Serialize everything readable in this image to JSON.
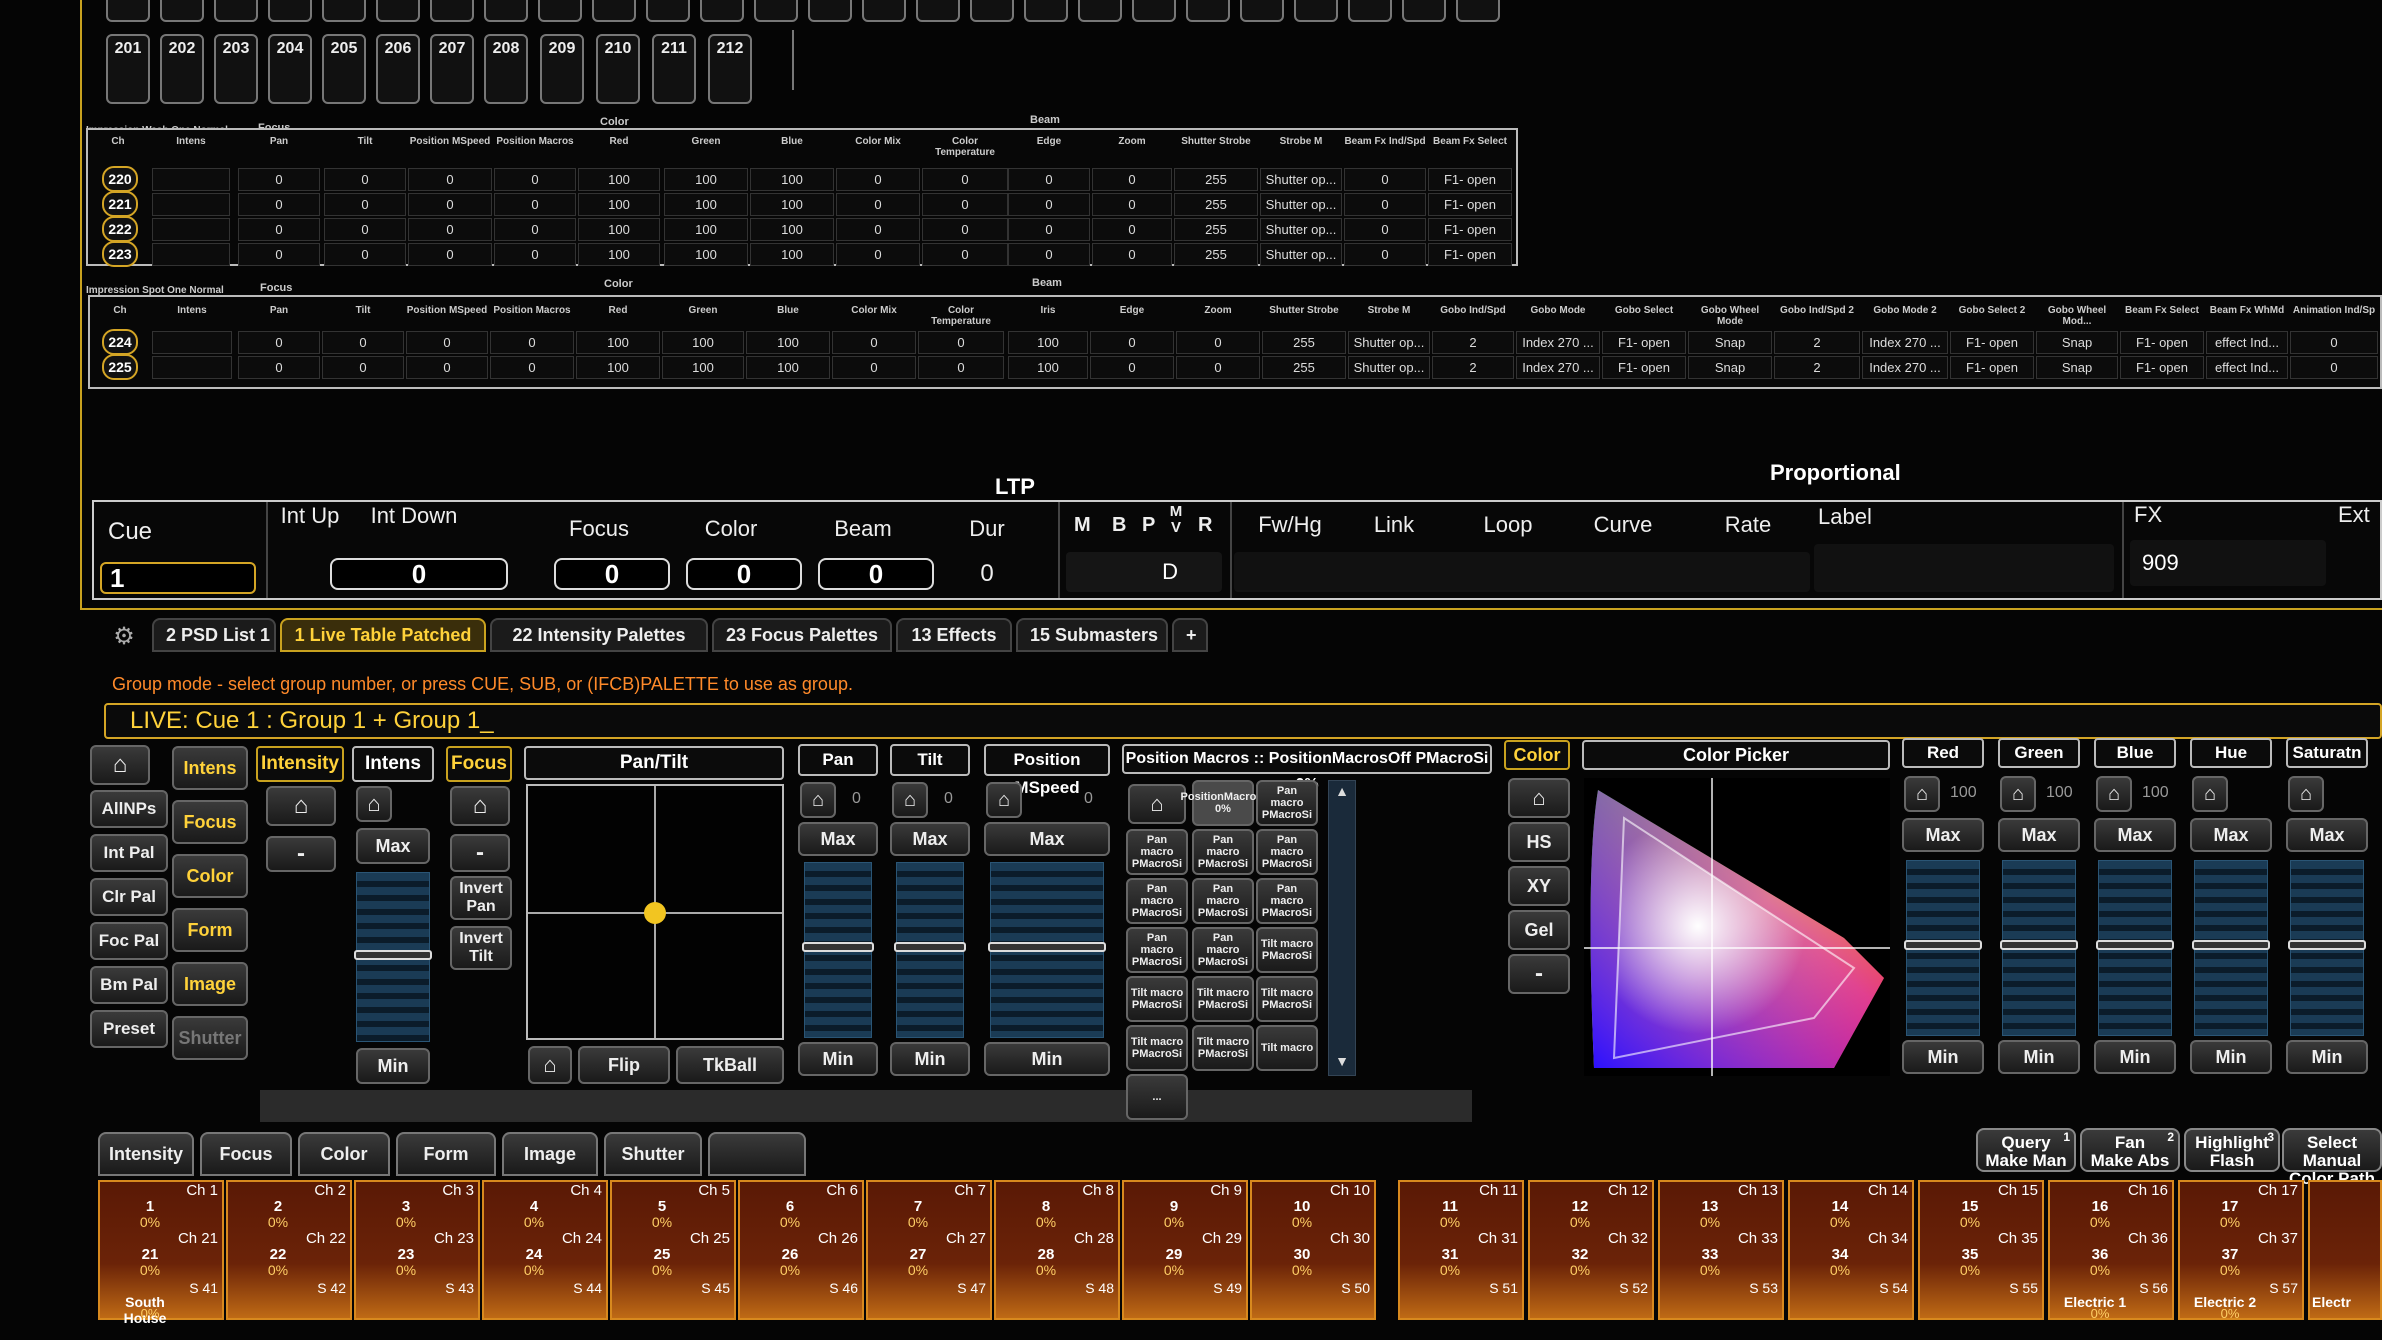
{
  "top_channels": [
    "201",
    "202",
    "203",
    "204",
    "205",
    "206",
    "207",
    "208",
    "209",
    "210",
    "211",
    "212"
  ],
  "table1": {
    "title": "Impression Wash One Normal",
    "groups": [
      "Focus",
      "Color",
      "Beam"
    ],
    "headers": [
      "Ch",
      "Intens",
      "Pan",
      "Tilt",
      "Position MSpeed",
      "Position Macros",
      "Red",
      "Green",
      "Blue",
      "Color Mix",
      "Color Temperature",
      "Edge",
      "Zoom",
      "Shutter Strobe",
      "Strobe M",
      "Beam Fx Ind/Spd",
      "Beam Fx Select"
    ],
    "rows": [
      {
        "ch": "220",
        "vals": [
          "0",
          "0",
          "0",
          "0",
          "100",
          "100",
          "100",
          "0",
          "0",
          "0",
          "0",
          "255",
          "Shutter op...",
          "0",
          "F1- open"
        ]
      },
      {
        "ch": "221",
        "vals": [
          "0",
          "0",
          "0",
          "0",
          "100",
          "100",
          "100",
          "0",
          "0",
          "0",
          "0",
          "255",
          "Shutter op...",
          "0",
          "F1- open"
        ]
      },
      {
        "ch": "222",
        "vals": [
          "0",
          "0",
          "0",
          "0",
          "100",
          "100",
          "100",
          "0",
          "0",
          "0",
          "0",
          "255",
          "Shutter op...",
          "0",
          "F1- open"
        ]
      },
      {
        "ch": "223",
        "vals": [
          "0",
          "0",
          "0",
          "0",
          "100",
          "100",
          "100",
          "0",
          "0",
          "0",
          "0",
          "255",
          "Shutter op...",
          "0",
          "F1- open"
        ]
      }
    ]
  },
  "table2": {
    "title": "Impression Spot One Normal",
    "groups": [
      "Focus",
      "Color",
      "Beam"
    ],
    "headers": [
      "Ch",
      "Intens",
      "Pan",
      "Tilt",
      "Position MSpeed",
      "Position Macros",
      "Red",
      "Green",
      "Blue",
      "Color Mix",
      "Color Temperature",
      "Iris",
      "Edge",
      "Zoom",
      "Shutter Strobe",
      "Strobe M",
      "Gobo Ind/Spd",
      "Gobo Mode",
      "Gobo Select",
      "Gobo Wheel Mode",
      "Gobo Ind/Spd 2",
      "Gobo Mode 2",
      "Gobo Select 2",
      "Gobo Wheel Mod...",
      "Beam Fx Select",
      "Beam Fx WhMd",
      "Animation Ind/Sp"
    ],
    "rows": [
      {
        "ch": "224",
        "vals": [
          "0",
          "0",
          "0",
          "0",
          "100",
          "100",
          "100",
          "0",
          "0",
          "100",
          "0",
          "0",
          "255",
          "Shutter op...",
          "2",
          "Index 270 ...",
          "F1- open",
          "Snap",
          "2",
          "Index 270 ...",
          "F1- open",
          "Snap",
          "F1- open",
          "effect Ind...",
          "0"
        ]
      },
      {
        "ch": "225",
        "vals": [
          "0",
          "0",
          "0",
          "0",
          "100",
          "100",
          "100",
          "0",
          "0",
          "100",
          "0",
          "0",
          "255",
          "Shutter op...",
          "2",
          "Index 270 ...",
          "F1- open",
          "Snap",
          "2",
          "Index 270 ...",
          "F1- open",
          "Snap",
          "F1- open",
          "effect Ind...",
          "0"
        ]
      }
    ]
  },
  "cue": {
    "ltp_label": "LTP",
    "prop_label": "Proportional",
    "headers": {
      "cue": "Cue",
      "int_up": "Int Up",
      "int_down": "Int Down",
      "focus": "Focus",
      "color": "Color",
      "beam": "Beam",
      "dur": "Dur",
      "m": "M",
      "b": "B",
      "p": "P",
      "mv": "M V",
      "r": "R",
      "fwhg": "Fw/Hg",
      "link": "Link",
      "loop": "Loop",
      "curve": "Curve",
      "rate": "Rate",
      "label": "Label",
      "fx": "FX",
      "ext": "Ext"
    },
    "values": {
      "cue": "1",
      "int_up": "0",
      "int_down": "0",
      "focus": "0",
      "color": "0",
      "beam": "0",
      "dur": "0",
      "flag": "D",
      "fx": "909"
    }
  },
  "tabs": [
    "2 PSD List 1",
    "1 Live Table Patched",
    "22 Intensity Palettes",
    "23 Focus Palettes",
    "13 Effects",
    "15 Submasters",
    "+"
  ],
  "hint": "Group mode - select group number, or press CUE, SUB, or (IFCB)PALETTE to use as group.",
  "command_line": "LIVE: Cue  1 :  Group 1 + Group 1_",
  "left_buttons": [
    "AllNPs",
    "Int Pal",
    "Clr Pal",
    "Foc Pal",
    "Bm Pal",
    "Preset"
  ],
  "cat_buttons": [
    "Intens",
    "Focus",
    "Color",
    "Form",
    "Image",
    "Shutter"
  ],
  "intensity": {
    "title": "Intensity",
    "intens": "Intens",
    "max": "Max",
    "min": "Min",
    "minus": "-"
  },
  "focus": {
    "title": "Focus",
    "minus": "-",
    "invert_pan": "Invert Pan",
    "invert_tilt": "Invert Tilt"
  },
  "pantilt": {
    "title": "Pan/Tilt",
    "flip": "Flip",
    "tkball": "TkBall"
  },
  "params": [
    {
      "name": "Pan",
      "val": "0"
    },
    {
      "name": "Tilt",
      "val": "0"
    },
    {
      "name": "Position MSpeed",
      "val": "0"
    }
  ],
  "macros": {
    "title": "Position Macros :: PositionMacrosOff PMacroSi 0%",
    "items": [
      "PositionMacrosi 0%",
      "Pan macro PMacroSi",
      "Pan macro PMacroSi",
      "Pan macro PMacroSi",
      "Pan macro PMacroSi",
      "Pan macro PMacroSi",
      "Pan macro PMacroSi",
      "Pan macro PMacroSi",
      "Pan macro PMacroSi",
      "Pan macro PMacroSi",
      "Tilt macro PMacroSi",
      "Tilt macro PMacroSi",
      "Tilt macro PMacroSi",
      "Tilt macro PMacroSi",
      "Tilt macro PMacroSi",
      "Tilt macro PMacroSi",
      "Tilt macro",
      "..."
    ]
  },
  "color": {
    "title": "Color",
    "hs": "HS",
    "xy": "XY",
    "gel": "Gel",
    "minus": "-",
    "picker": "Color Picker"
  },
  "color_params": [
    {
      "name": "Red",
      "val": "100"
    },
    {
      "name": "Green",
      "val": "100"
    },
    {
      "name": "Blue",
      "val": "100"
    },
    {
      "name": "Hue",
      "val": ""
    },
    {
      "name": "Saturatn",
      "val": ""
    }
  ],
  "fader_labels": {
    "max": "Max",
    "min": "Min"
  },
  "bottom_cats": [
    "Intensity",
    "Focus",
    "Color",
    "Form",
    "Image",
    "Shutter",
    ""
  ],
  "mode_buttons": [
    {
      "l1": "Query",
      "l2": "Make Man",
      "n": "1"
    },
    {
      "l1": "Fan",
      "l2": "Make Abs",
      "n": "2"
    },
    {
      "l1": "Highlight",
      "l2": "Flash",
      "n": "3"
    },
    {
      "l1": "Select Manual",
      "l2": "Color Path",
      "n": ""
    }
  ],
  "channels_top": [
    {
      "ch": "Ch 1",
      "n": "1",
      "p": "0%"
    },
    {
      "ch": "Ch 2",
      "n": "2",
      "p": "0%"
    },
    {
      "ch": "Ch 3",
      "n": "3",
      "p": "0%"
    },
    {
      "ch": "Ch 4",
      "n": "4",
      "p": "0%"
    },
    {
      "ch": "Ch 5",
      "n": "5",
      "p": "0%"
    },
    {
      "ch": "Ch 6",
      "n": "6",
      "p": "0%"
    },
    {
      "ch": "Ch 7",
      "n": "7",
      "p": "0%"
    },
    {
      "ch": "Ch 8",
      "n": "8",
      "p": "0%"
    },
    {
      "ch": "Ch 9",
      "n": "9",
      "p": "0%"
    },
    {
      "ch": "Ch 10",
      "n": "10",
      "p": "0%"
    },
    {
      "ch": "Ch 11",
      "n": "11",
      "p": "0%"
    },
    {
      "ch": "Ch 12",
      "n": "12",
      "p": "0%"
    },
    {
      "ch": "Ch 13",
      "n": "13",
      "p": "0%"
    },
    {
      "ch": "Ch 14",
      "n": "14",
      "p": "0%"
    },
    {
      "ch": "Ch 15",
      "n": "15",
      "p": "0%"
    },
    {
      "ch": "Ch 16",
      "n": "16",
      "p": "0%"
    },
    {
      "ch": "Ch 17",
      "n": "17",
      "p": "0%"
    }
  ],
  "channels_mid": [
    {
      "ch": "Ch 21",
      "n": "21",
      "p": "0%"
    },
    {
      "ch": "Ch 22",
      "n": "22",
      "p": "0%"
    },
    {
      "ch": "Ch 23",
      "n": "23",
      "p": "0%"
    },
    {
      "ch": "Ch 24",
      "n": "24",
      "p": "0%"
    },
    {
      "ch": "Ch 25",
      "n": "25",
      "p": "0%"
    },
    {
      "ch": "Ch 26",
      "n": "26",
      "p": "0%"
    },
    {
      "ch": "Ch 27",
      "n": "27",
      "p": "0%"
    },
    {
      "ch": "Ch 28",
      "n": "28",
      "p": "0%"
    },
    {
      "ch": "Ch 29",
      "n": "29",
      "p": "0%"
    },
    {
      "ch": "Ch 30",
      "n": "30",
      "p": "0%"
    },
    {
      "ch": "Ch 31",
      "n": "31",
      "p": "0%"
    },
    {
      "ch": "Ch 32",
      "n": "32",
      "p": "0%"
    },
    {
      "ch": "Ch 33",
      "n": "33",
      "p": "0%"
    },
    {
      "ch": "Ch 34",
      "n": "34",
      "p": "0%"
    },
    {
      "ch": "Ch 35",
      "n": "35",
      "p": "0%"
    },
    {
      "ch": "Ch 36",
      "n": "36",
      "p": "0%"
    },
    {
      "ch": "Ch 37",
      "n": "37",
      "p": "0%"
    }
  ],
  "subs": [
    {
      "s": "S 41",
      "name": "South House",
      "p": "0%"
    },
    {
      "s": "S 42",
      "name": "",
      "p": ""
    },
    {
      "s": "S 43",
      "name": "",
      "p": ""
    },
    {
      "s": "S 44",
      "name": "",
      "p": ""
    },
    {
      "s": "S 45",
      "name": "",
      "p": ""
    },
    {
      "s": "S 46",
      "name": "",
      "p": ""
    },
    {
      "s": "S 47",
      "name": "",
      "p": ""
    },
    {
      "s": "S 48",
      "name": "",
      "p": ""
    },
    {
      "s": "S 49",
      "name": "",
      "p": ""
    },
    {
      "s": "S 50",
      "name": "",
      "p": ""
    },
    {
      "s": "S 51",
      "name": "",
      "p": ""
    },
    {
      "s": "S 52",
      "name": "",
      "p": ""
    },
    {
      "s": "S 53",
      "name": "",
      "p": ""
    },
    {
      "s": "S 54",
      "name": "",
      "p": ""
    },
    {
      "s": "S 55",
      "name": "",
      "p": ""
    },
    {
      "s": "S 56",
      "name": "Electric 1",
      "p": "0%"
    },
    {
      "s": "S 57",
      "name": "Electric 2",
      "p": "0%"
    }
  ],
  "extra_sub": "Electr",
  "colors": {
    "accent": "#c9a21f",
    "highlight": "#ffd23a",
    "hint": "#ff8a2a",
    "channel_bg": "#6b2308"
  }
}
